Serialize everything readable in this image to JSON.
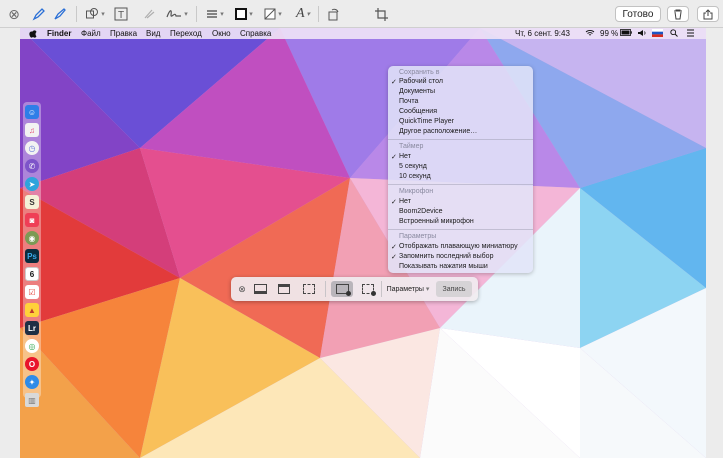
{
  "toolbar": {
    "done_label": "Готово",
    "icons": [
      "close-icon",
      "pen-icon",
      "highlighter-icon",
      "shapes-icon",
      "text-icon",
      "eraser-icon",
      "signature-icon",
      "line-style-icon",
      "border-color-icon",
      "fill-color-icon",
      "font-icon",
      "rotate-icon",
      "crop-icon",
      "trash-icon",
      "share-icon"
    ]
  },
  "menubar": {
    "apple": "",
    "app": "Finder",
    "items": [
      "Файл",
      "Правка",
      "Вид",
      "Переход",
      "Окно",
      "Справка"
    ],
    "datetime": "Чт, 6 сент. 9:43",
    "battery": "99 %"
  },
  "options_menu": {
    "save_header": "Сохранить в",
    "save_items": [
      "Рабочий стол",
      "Документы",
      "Почта",
      "Сообщения",
      "QuickTime Player",
      "Другое расположение…"
    ],
    "timer_header": "Таймер",
    "timer_items": [
      "Нет",
      "5 секунд",
      "10 секунд"
    ],
    "mic_header": "Микрофон",
    "mic_items": [
      "Нет",
      "Boom2Device",
      "Встроенный микрофон"
    ],
    "params_header": "Параметры",
    "params_items": [
      "Отображать плавающую миниатюру",
      "Запомнить последний выбор",
      "Показывать нажатия мыши"
    ]
  },
  "capture_bar": {
    "options_label": "Параметры",
    "record_label": "Запись"
  }
}
